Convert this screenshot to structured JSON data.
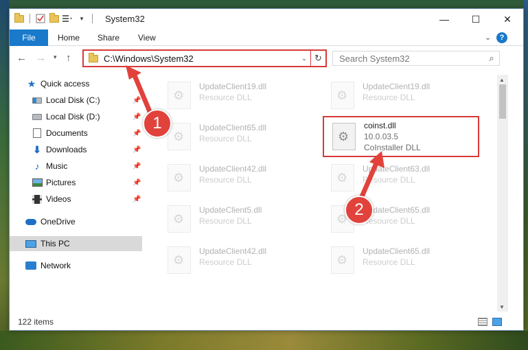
{
  "window": {
    "title": "System32",
    "minimize": "—",
    "maximize": "☐",
    "close": "✕"
  },
  "ribbon": {
    "file": "File",
    "home": "Home",
    "share": "Share",
    "view": "View",
    "collapse": "⌄",
    "help": "?"
  },
  "nav": {
    "back": "←",
    "forward": "→",
    "recent": "▾",
    "up": "↑",
    "address": "C:\\Windows\\System32",
    "address_dropdown": "⌄",
    "refresh": "↻",
    "search_placeholder": "Search System32",
    "search_icon": "⌕"
  },
  "sidebar": {
    "items": [
      {
        "label": "Quick access",
        "icon": "star-icon"
      },
      {
        "label": "Local Disk (C:)",
        "icon": "drive-icon"
      },
      {
        "label": "Local Disk (D:)",
        "icon": "drive-icon"
      },
      {
        "label": "Documents",
        "icon": "document-icon"
      },
      {
        "label": "Downloads",
        "icon": "download-icon"
      },
      {
        "label": "Music",
        "icon": "music-icon"
      },
      {
        "label": "Pictures",
        "icon": "pictures-icon"
      },
      {
        "label": "Videos",
        "icon": "videos-icon"
      },
      {
        "label": "OneDrive",
        "icon": "cloud-icon"
      },
      {
        "label": "This PC",
        "icon": "computer-icon"
      },
      {
        "label": "Network",
        "icon": "network-icon"
      }
    ],
    "pin": "📌"
  },
  "files": {
    "left": [
      {
        "name": "UpdateClient19.dll",
        "type": "Resource DLL"
      },
      {
        "name": "UpdateClient65.dll",
        "type": "Resource DLL"
      },
      {
        "name": "UpdateClient42.dll",
        "type": "Resource DLL"
      },
      {
        "name": "UpdateClient5.dll",
        "type": "Resource DLL"
      },
      {
        "name": "UpdateClient42.dll",
        "type": "Resource DLL"
      }
    ],
    "right": [
      {
        "name": "UpdateClient19.dll",
        "type": "Resource DLL"
      },
      {
        "name": "UpdateClient63.dll",
        "type": "Resource DLL"
      },
      {
        "name": "UpdateClient65.dll",
        "type": "Resource DLL"
      },
      {
        "name": "UpdateClient65.dll",
        "type": "Resource DLL"
      }
    ],
    "highlighted": {
      "name": "coinst.dll",
      "version": "10.0.03.5",
      "description": "CoInstaller DLL"
    }
  },
  "status": {
    "item_count": "122 items"
  },
  "annotations": {
    "step1": "1",
    "step2": "2",
    "color": "#e1423c"
  },
  "colors": {
    "accent": "#1979ca",
    "highlight_border": "#d83838"
  }
}
